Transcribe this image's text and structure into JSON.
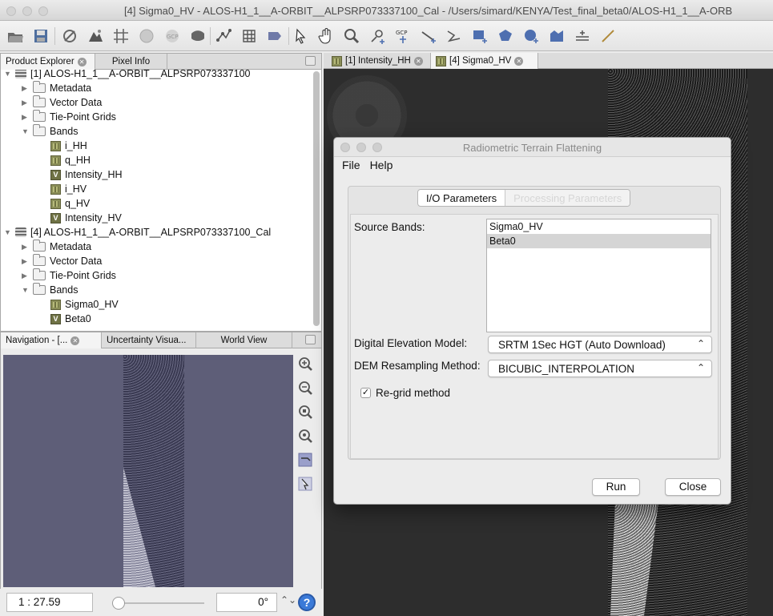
{
  "window": {
    "title": "[4] Sigma0_HV - ALOS-H1_1__A-ORBIT__ALPSRP073337100_Cal - /Users/simard/KENYA/Test_final_beta0/ALOS-H1_1__A-ORB"
  },
  "toolbar": {
    "icons": [
      "open-product-icon",
      "save-product-icon",
      "no-data-overlay-icon",
      "range-finder-icon",
      "graticule-icon",
      "world-map-icon",
      "gcp-layer-icon",
      "mask-icon",
      "vector-graph-icon",
      "pin-grid-icon",
      "pin-manager-icon",
      "select-tool-icon",
      "pan-tool-icon",
      "zoom-tool-icon",
      "pin-tool-icon",
      "gcp-tool-icon",
      "line-draw-icon",
      "polyline-draw-icon",
      "rectangle-draw-icon",
      "polygon-draw-icon",
      "ellipse-draw-icon",
      "insert-figure-icon",
      "magic-wand-icon",
      "measure-icon"
    ],
    "gcp_label": "GCP"
  },
  "product_explorer": {
    "tabs": [
      "Product Explorer",
      "Pixel Info"
    ],
    "tree": [
      {
        "label": "[1] ALOS-H1_1__A-ORBIT__ALPSRP073337100",
        "kind": "product",
        "level": 0,
        "expanded": true
      },
      {
        "label": "Metadata",
        "kind": "folder",
        "level": 1,
        "expanded": false
      },
      {
        "label": "Vector Data",
        "kind": "folder",
        "level": 1,
        "expanded": false
      },
      {
        "label": "Tie-Point Grids",
        "kind": "folder",
        "level": 1,
        "expanded": false
      },
      {
        "label": "Bands",
        "kind": "folder",
        "level": 1,
        "expanded": true
      },
      {
        "label": "i_HH",
        "kind": "band",
        "level": 2
      },
      {
        "label": "q_HH",
        "kind": "band",
        "level": 2
      },
      {
        "label": "Intensity_HH",
        "kind": "virtual",
        "level": 2
      },
      {
        "label": "i_HV",
        "kind": "band",
        "level": 2
      },
      {
        "label": "q_HV",
        "kind": "band",
        "level": 2
      },
      {
        "label": "Intensity_HV",
        "kind": "virtual",
        "level": 2
      },
      {
        "label": "[4] ALOS-H1_1__A-ORBIT__ALPSRP073337100_Cal",
        "kind": "product",
        "level": 0,
        "expanded": true
      },
      {
        "label": "Metadata",
        "kind": "folder",
        "level": 1,
        "expanded": false
      },
      {
        "label": "Vector Data",
        "kind": "folder",
        "level": 1,
        "expanded": false
      },
      {
        "label": "Tie-Point Grids",
        "kind": "folder",
        "level": 1,
        "expanded": false
      },
      {
        "label": "Bands",
        "kind": "folder",
        "level": 1,
        "expanded": true
      },
      {
        "label": "Sigma0_HV",
        "kind": "band",
        "level": 2
      },
      {
        "label": "Beta0",
        "kind": "virtual",
        "level": 2
      }
    ]
  },
  "navigation_panel": {
    "tabs": [
      "Navigation - [...",
      "Uncertainty Visua...",
      "World View"
    ],
    "zoom_buttons": [
      "zoom-in-icon",
      "zoom-out-icon",
      "zoom-pixel-icon",
      "zoom-all-icon",
      "sync-views-icon",
      "sync-cursor-icon"
    ],
    "scale_value": "1 : 27.59",
    "rotation_value": "0°",
    "help_icon": "help-icon"
  },
  "image_tabs": [
    {
      "label": "[1] Intensity_HH",
      "active": false
    },
    {
      "label": "[4] Sigma0_HV",
      "active": true
    }
  ],
  "dialog": {
    "title": "Radiometric Terrain Flattening",
    "menu": [
      "File",
      "Help"
    ],
    "tabs": [
      "I/O Parameters",
      "Processing Parameters"
    ],
    "source_bands_label": "Source Bands:",
    "source_bands": [
      {
        "name": "Sigma0_HV",
        "selected": false
      },
      {
        "name": "Beta0",
        "selected": true
      }
    ],
    "dem_label": "Digital Elevation Model:",
    "dem_value": "SRTM 1Sec HGT (Auto Download)",
    "resampling_label": "DEM Resampling Method:",
    "resampling_value": "BICUBIC_INTERPOLATION",
    "regrid_label": "Re-grid method",
    "regrid_checked": true,
    "run_label": "Run",
    "close_label": "Close"
  }
}
